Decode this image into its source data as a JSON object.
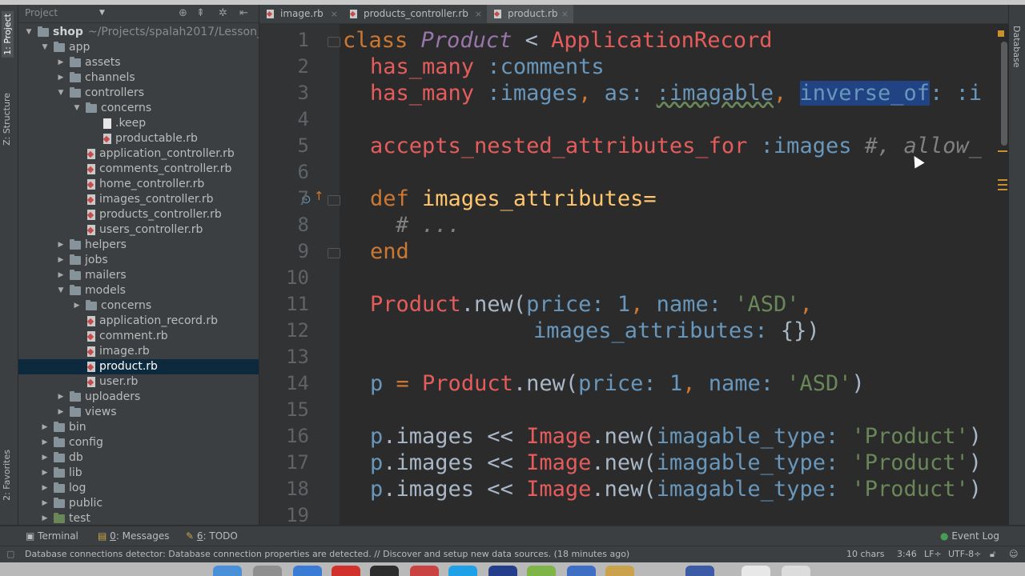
{
  "left_tools": {
    "project": "1: Project",
    "structure": "Z: Structure",
    "favorites": "2: Favorites"
  },
  "right_tools": {
    "database": "Database"
  },
  "project_panel": {
    "title": "Project",
    "tree": [
      {
        "label": "shop",
        "path": "~/Projects/spalah2017/Lesson_"
      },
      {
        "label": "app"
      },
      {
        "label": "assets"
      },
      {
        "label": "channels"
      },
      {
        "label": "controllers"
      },
      {
        "label": "concerns"
      },
      {
        "label": ".keep"
      },
      {
        "label": "productable.rb"
      },
      {
        "label": "application_controller.rb"
      },
      {
        "label": "comments_controller.rb"
      },
      {
        "label": "home_controller.rb"
      },
      {
        "label": "images_controller.rb"
      },
      {
        "label": "products_controller.rb"
      },
      {
        "label": "users_controller.rb"
      },
      {
        "label": "helpers"
      },
      {
        "label": "jobs"
      },
      {
        "label": "mailers"
      },
      {
        "label": "models"
      },
      {
        "label": "concerns"
      },
      {
        "label": "application_record.rb"
      },
      {
        "label": "comment.rb"
      },
      {
        "label": "image.rb"
      },
      {
        "label": "product.rb"
      },
      {
        "label": "user.rb"
      },
      {
        "label": "uploaders"
      },
      {
        "label": "views"
      },
      {
        "label": "bin"
      },
      {
        "label": "config"
      },
      {
        "label": "db"
      },
      {
        "label": "lib"
      },
      {
        "label": "log"
      },
      {
        "label": "public"
      },
      {
        "label": "test"
      }
    ]
  },
  "tabs": [
    {
      "label": "image.rb",
      "close": "×"
    },
    {
      "label": "products_controller.rb",
      "close": "×"
    },
    {
      "label": "product.rb",
      "close": "×"
    }
  ],
  "editor": {
    "line_numbers": [
      "1",
      "2",
      "3",
      "4",
      "5",
      "6",
      "7",
      "8",
      "9",
      "10",
      "11",
      "12",
      "13",
      "14",
      "15",
      "16",
      "17",
      "18",
      "19"
    ],
    "code": {
      "l1_kw": "class",
      "l1_name": "Product",
      "l1_lt": " < ",
      "l1_parent": "ApplicationRecord",
      "l2_a": "has_many",
      "l2_b": ":comments",
      "l3_a": "has_many",
      "l3_b": ":images",
      "l3_c": ", ",
      "l3_d": "as:",
      "l3_e": " ",
      "l3_f": ":imagable",
      "l3_g": ", ",
      "l3_h": "inverse_of",
      "l3_i": ": :i",
      "l5_a": "accepts_nested_attributes_for",
      "l5_b": ":images",
      "l5_c": " #, allow_",
      "l7_a": "def",
      "l7_b": " images_attributes=",
      "l8": "# ...",
      "l9": "end",
      "l11_a": "Product",
      "l11_b": ".new(",
      "l11_c": "price:",
      "l11_d": " ",
      "l11_e": "1",
      "l11_f": ", ",
      "l11_g": "name:",
      "l11_h": " ",
      "l11_i": "'ASD'",
      "l11_j": ",",
      "l12_a": "images_attributes:",
      "l12_b": " {})",
      "l14_a": "p",
      "l14_b": " = ",
      "l14_c": "Product",
      "l14_d": ".new(",
      "l14_e": "price:",
      "l14_f": " ",
      "l14_g": "1",
      "l14_h": ", ",
      "l14_i": "name:",
      "l14_j": " ",
      "l14_k": "'ASD'",
      "l14_l": ")",
      "l16_a": "p",
      "l16_b": ".images << ",
      "l16_c": "Image",
      "l16_d": ".new(",
      "l16_e": "imagable_type:",
      "l16_f": " ",
      "l16_g": "'Product'",
      "l16_h": ")"
    }
  },
  "bottom_tools": {
    "terminal": "Terminal",
    "messages_num": "0",
    "messages": ": Messages",
    "todo_num": "6",
    "todo": ": TODO",
    "event_log": "Event Log"
  },
  "status": {
    "message": "Database connections detector: Database connection properties are detected. // Discover and setup new data sources. (18 minutes ago)",
    "chars": "10 chars",
    "position": "3:46",
    "line_sep": "LF÷",
    "encoding": "UTF-8÷"
  },
  "colors": {
    "editor_bg": "#2b2b2b",
    "panel_bg": "#3c3f41",
    "keyword": "#cc7832",
    "class": "#e55c5c",
    "symbol": "#6897bb",
    "string": "#6a8759",
    "selection": "#214283"
  }
}
